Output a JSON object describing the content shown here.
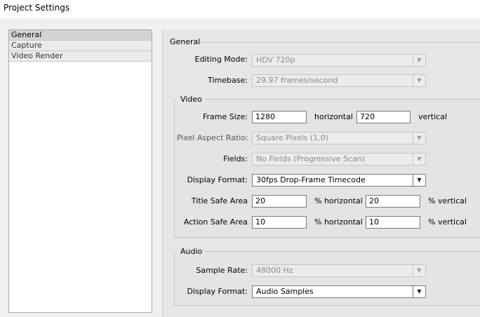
{
  "window": {
    "title": "Project Settings"
  },
  "nav": {
    "items": [
      {
        "label": "General",
        "selected": true
      },
      {
        "label": "Capture",
        "selected": false
      },
      {
        "label": "Video Render",
        "selected": false
      }
    ]
  },
  "general": {
    "heading": "General",
    "editing_mode": {
      "label": "Editing Mode:",
      "value": "HDV 720p"
    },
    "timebase": {
      "label": "Timebase:",
      "value": "29.97 frames/second"
    }
  },
  "video": {
    "heading": "Video",
    "frame_size": {
      "label": "Frame Size:",
      "horizontal": "1280",
      "horizontal_unit": "horizontal",
      "vertical": "720",
      "vertical_unit": "vertical"
    },
    "pixel_aspect_ratio": {
      "label": "Pixel Aspect Ratio:",
      "value": "Square Pixels (1.0)"
    },
    "fields": {
      "label": "Fields:",
      "value": "No Fields (Progressive Scan)"
    },
    "display_format": {
      "label": "Display Format:",
      "value": "30fps Drop-Frame Timecode"
    },
    "title_safe": {
      "label": "Title Safe Area",
      "horizontal": "20",
      "horizontal_unit": "% horizontal",
      "vertical": "20",
      "vertical_unit": "% vertical"
    },
    "action_safe": {
      "label": "Action Safe Area",
      "horizontal": "10",
      "horizontal_unit": "% horizontal",
      "vertical": "10",
      "vertical_unit": "% vertical"
    }
  },
  "audio": {
    "heading": "Audio",
    "sample_rate": {
      "label": "Sample Rate:",
      "value": "48000 Hz"
    },
    "display_format": {
      "label": "Display Format:",
      "value": "Audio Samples"
    }
  },
  "icons": {
    "dropdown": "chevron-down-icon"
  }
}
